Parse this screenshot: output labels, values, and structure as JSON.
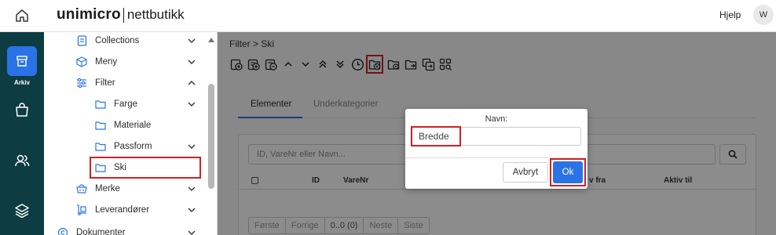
{
  "header": {
    "logo_main": "unimicro",
    "logo_sub": "nettbutikk",
    "help_label": "Hjelp",
    "avatar_initial": "W"
  },
  "rail": {
    "active_label": "Arkiv",
    "items": [
      {
        "icon": "archive-icon",
        "label": "Arkiv"
      },
      {
        "icon": "shopping-bag-icon"
      },
      {
        "icon": "users-icon"
      },
      {
        "icon": "layers-icon"
      }
    ]
  },
  "sidebar": {
    "items": [
      {
        "label": "Collections",
        "icon": "document-icon",
        "expand": "chevron-down"
      },
      {
        "label": "Meny",
        "icon": "cube-icon",
        "expand": "chevron-down"
      },
      {
        "label": "Filter",
        "icon": "sliders-icon",
        "expand": "chevron-up"
      },
      {
        "label": "Farge",
        "icon": "folder-icon",
        "expand": "chevron-down"
      },
      {
        "label": "Materiale",
        "icon": "folder-icon"
      },
      {
        "label": "Passform",
        "icon": "folder-icon",
        "expand": "chevron-down"
      },
      {
        "label": "Ski",
        "icon": "folder-icon",
        "highlighted": true
      },
      {
        "label": "Merke",
        "icon": "basket-icon",
        "expand": "chevron-down"
      },
      {
        "label": "Leverandører",
        "icon": "hand-truck-icon",
        "expand": "chevron-down"
      },
      {
        "label": "Dokumenter",
        "icon": "copyright-icon",
        "expand": "chevron-down"
      }
    ]
  },
  "main": {
    "breadcrumb": "Filter > Ski",
    "tabs": [
      {
        "label": "Elementer",
        "active": true
      },
      {
        "label": "Underkategorier",
        "active": false
      }
    ],
    "search_placeholder": "ID, VareNr eller Navn...",
    "grid_columns": [
      "ID",
      "VareNr",
      "v fra",
      "Aktiv til"
    ],
    "pager": [
      "Første",
      "Forrige",
      "0..0 (0)",
      "Neste",
      "Siste"
    ]
  },
  "modal": {
    "label": "Navn:",
    "input_value": "Bredde",
    "cancel_label": "Avbryt",
    "ok_label": "Ok"
  },
  "colors": {
    "accent": "#2a73e6",
    "rail_bg": "#0d3c43",
    "highlight": "#d12027"
  }
}
